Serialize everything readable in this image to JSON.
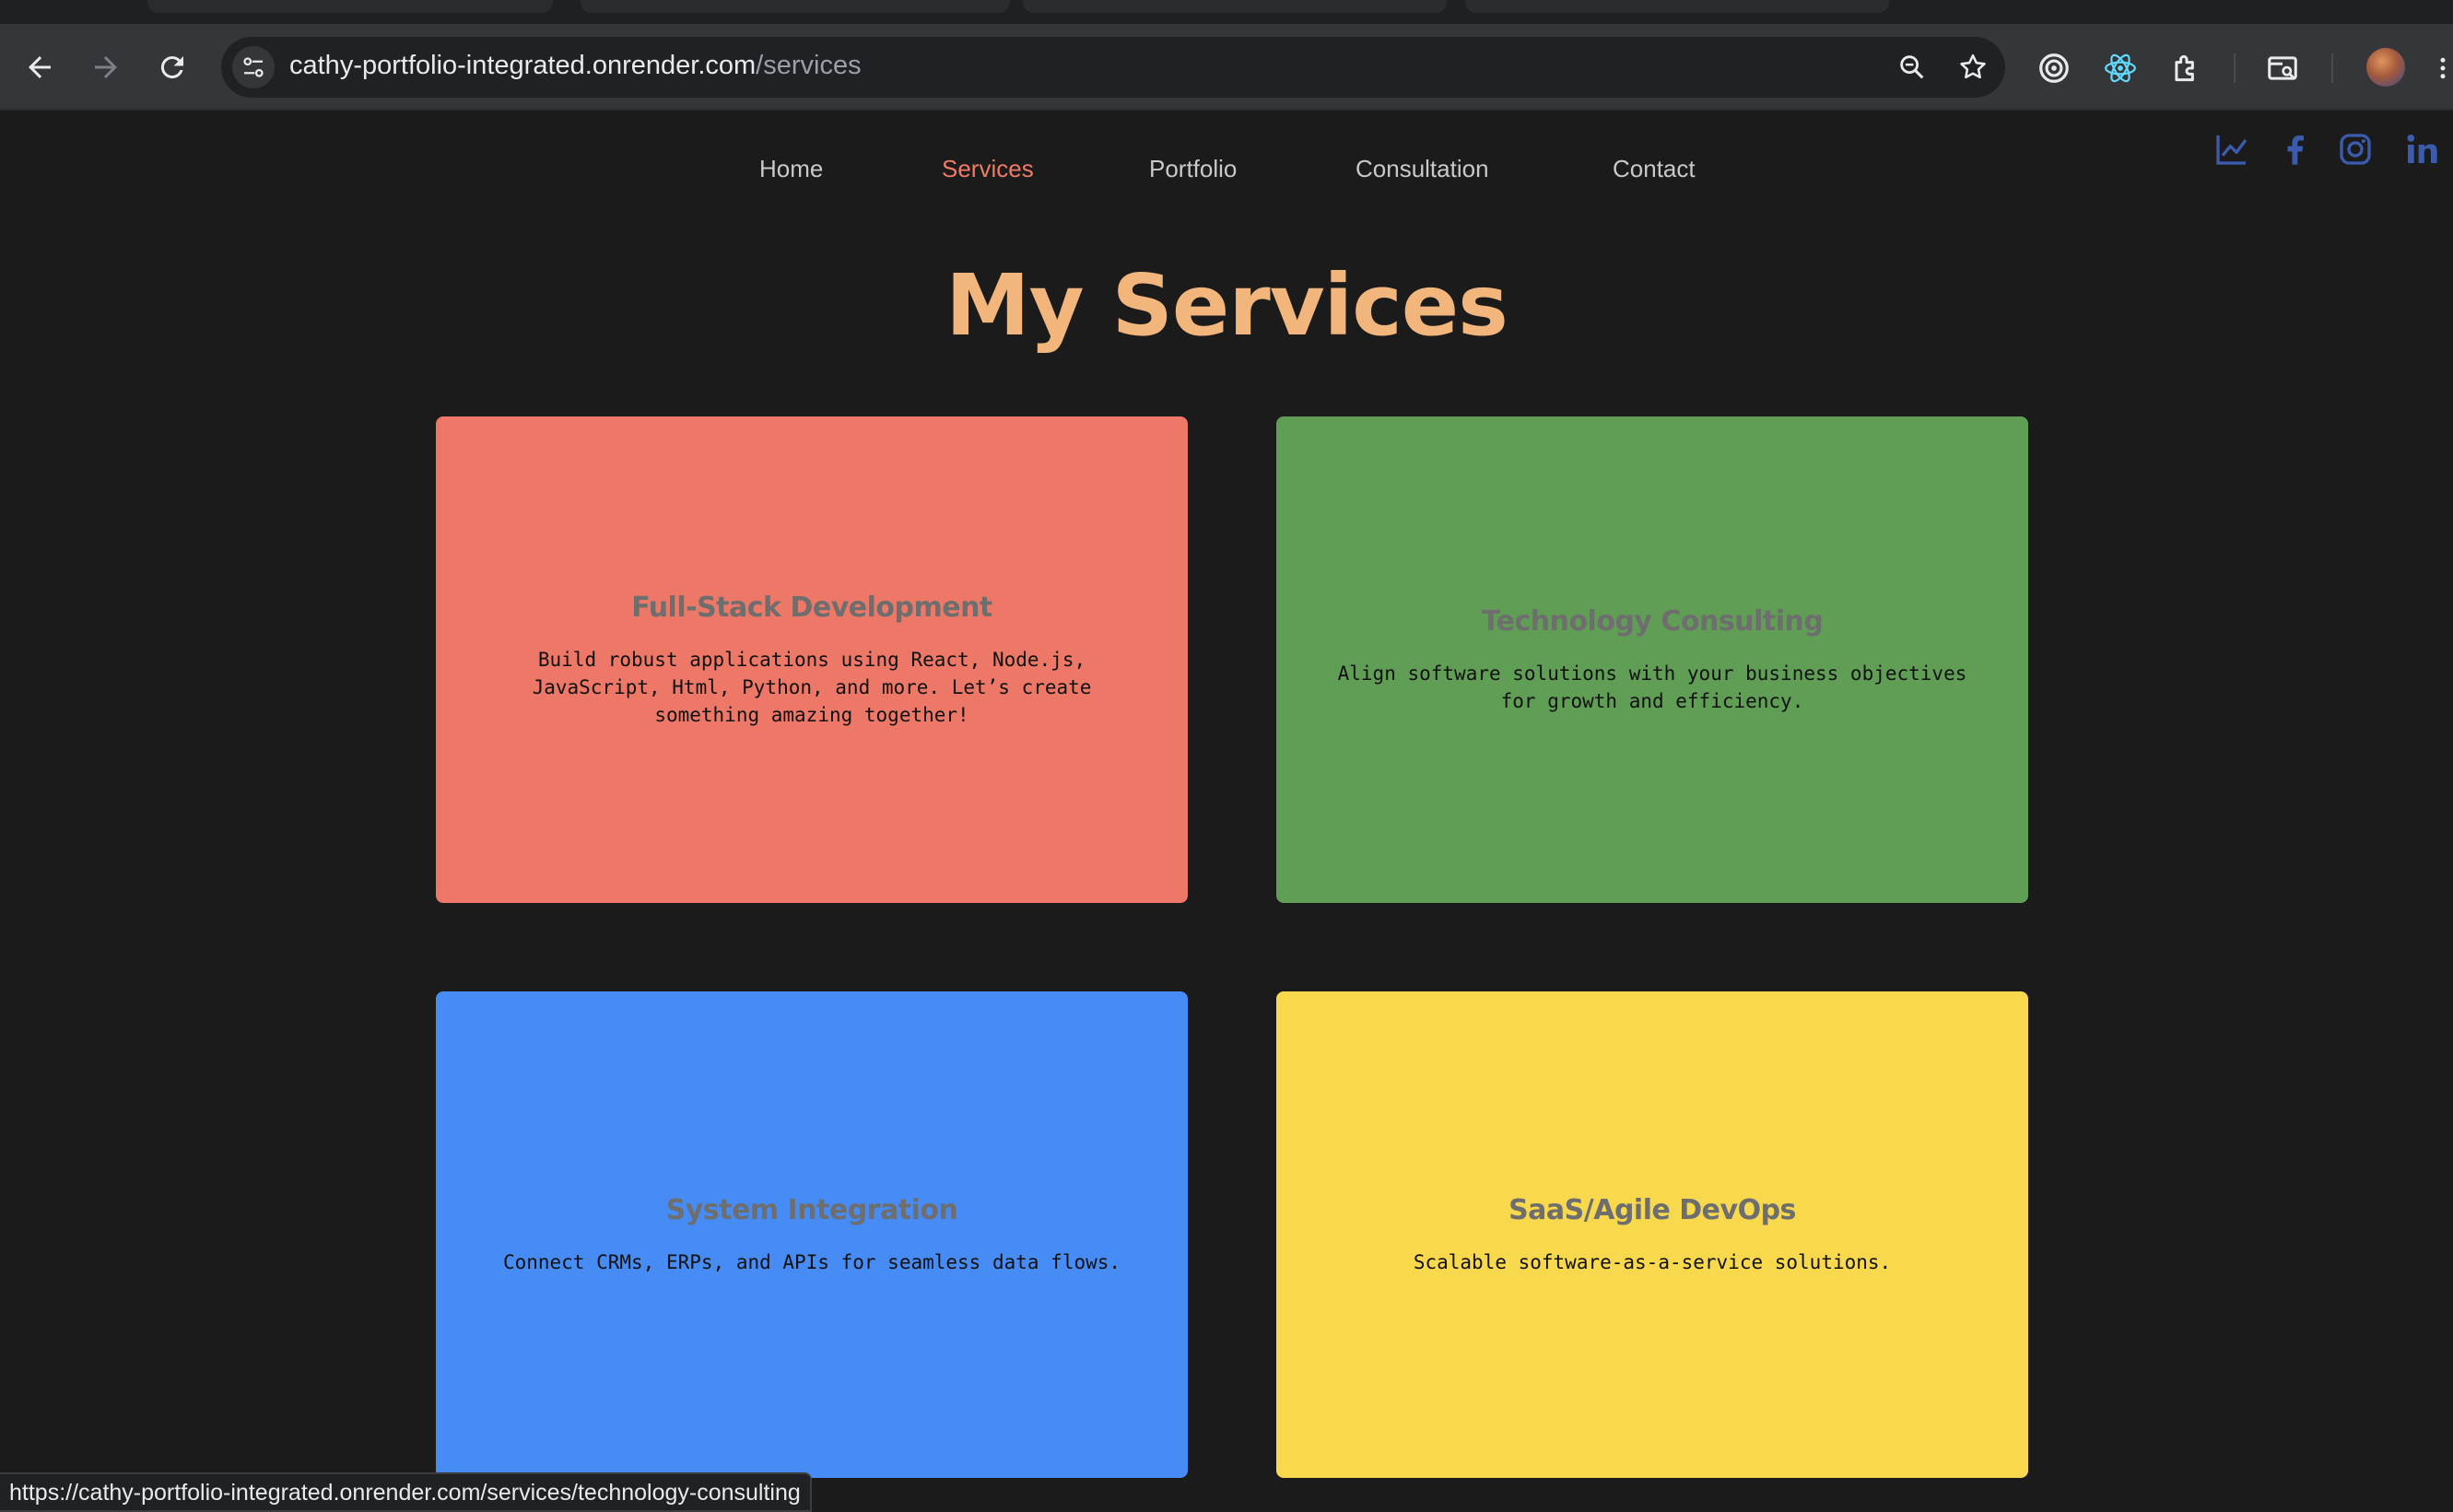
{
  "browser": {
    "url_host": "cathy-portfolio-integrated.onrender.com",
    "url_path": "/services",
    "status_url": "https://cathy-portfolio-integrated.onrender.com/services/technology-consulting"
  },
  "nav": {
    "items": [
      {
        "label": "Home"
      },
      {
        "label": "Services"
      },
      {
        "label": "Portfolio"
      },
      {
        "label": "Consultation"
      },
      {
        "label": "Contact"
      }
    ],
    "active_index": 1
  },
  "social_icons": [
    "chart-line-icon",
    "facebook-icon",
    "instagram-icon",
    "linkedin-icon"
  ],
  "page_title": "My Services",
  "services": [
    {
      "title": "Full-Stack Development",
      "description": "Build robust applications using React, Node.js, JavaScript, Html, Python, and more. Let’s create something amazing together!",
      "color": "#ed7867"
    },
    {
      "title": "Technology Consulting",
      "description": "Align software solutions with your business objectives for growth and efficiency.",
      "color": "#609e56"
    },
    {
      "title": "System Integration",
      "description": "Connect CRMs, ERPs, and APIs for seamless data flows.",
      "color": "#468cf4"
    },
    {
      "title": "SaaS/Agile DevOps",
      "description": "Scalable software-as-a-service solutions.",
      "color": "#f8d84d"
    }
  ],
  "colors": {
    "accent": "#f07a64",
    "title": "#f2b67c",
    "social": "#3b5cad",
    "background": "#1b1b1c"
  }
}
